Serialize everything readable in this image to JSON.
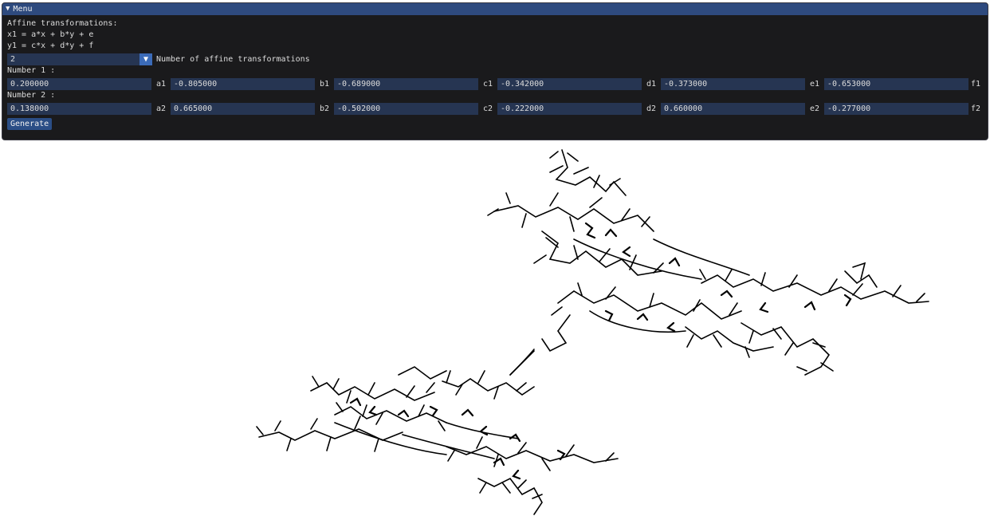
{
  "window": {
    "title": "Menu",
    "collapse_glyph": "▼"
  },
  "header_lines": [
    "Affine transformations:",
    "x1 = a*x + b*y + e",
    "y1 = c*x + d*y + f"
  ],
  "count_combo": {
    "value": "2",
    "arrow": "▼",
    "label": "Number of affine transformations"
  },
  "transforms": [
    {
      "title": "Number 1 :",
      "values": [
        "0.200000",
        "-0.805000",
        "-0.689000",
        "-0.342000",
        "-0.373000",
        "-0.653000"
      ],
      "labels": [
        "a1",
        "b1",
        "c1",
        "d1",
        "e1",
        "f1"
      ]
    },
    {
      "title": "Number 2 :",
      "values": [
        "0.138000",
        "0.665000",
        "-0.502000",
        "-0.222000",
        "0.660000",
        "-0.277000"
      ],
      "labels": [
        "a2",
        "b2",
        "c2",
        "d2",
        "e2",
        "f2"
      ]
    }
  ],
  "generate_label": "Generate",
  "colors": {
    "title_bar": "#2e4a7e",
    "field_bg": "#263552",
    "panel_bg": "#1a1a1c",
    "fractal": "#000000"
  }
}
